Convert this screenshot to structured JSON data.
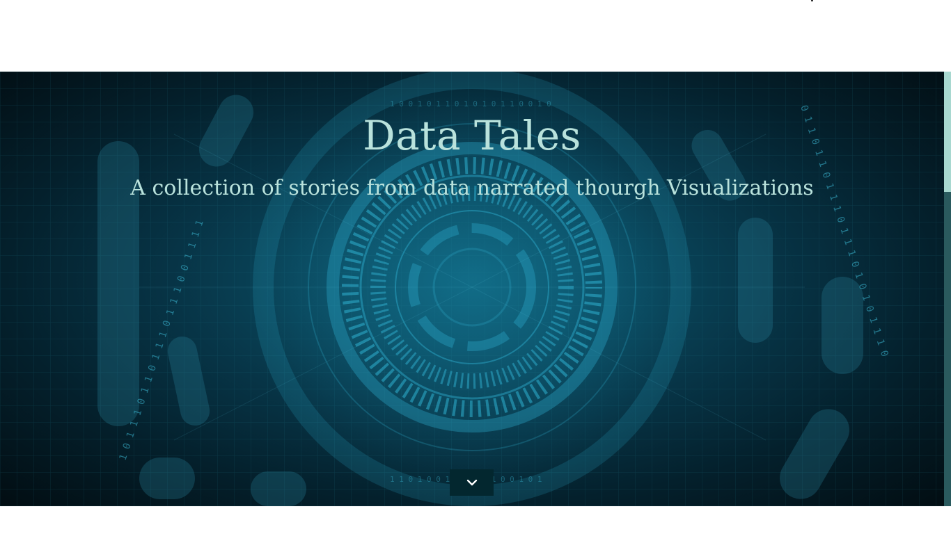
{
  "hero": {
    "title": "Data Tales",
    "subtitle": "A collection of stories from data narrated thourgh Visualizations"
  },
  "scroll_button": {
    "icon": "chevron-down-icon"
  },
  "colors": {
    "hero_text": "#b9e2dc",
    "hero_bg_center": "#0d5a72",
    "hero_bg_edge": "#020d12",
    "scroll_button_bg": "#03272f",
    "scrollbar_thumb": "#a8d8d0",
    "scrollbar_track": "#2a5a5e"
  }
}
